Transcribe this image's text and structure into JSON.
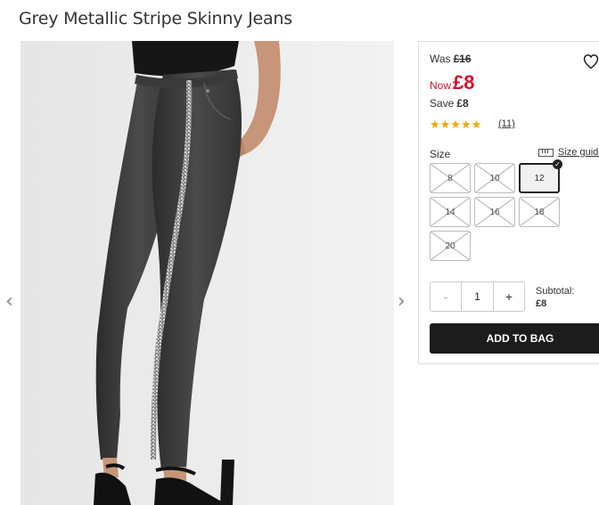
{
  "product": {
    "title": "Grey Metallic Stripe Skinny Jeans"
  },
  "gallery": {
    "prev_icon": "chevron-left-icon",
    "prev_glyph": "‹",
    "next_icon": "chevron-right-icon",
    "next_glyph": "›"
  },
  "pricing": {
    "was_label": "Was",
    "was_price": "£16",
    "now_label": "Now",
    "now_price": "£8",
    "save_label": "Save",
    "save_amount": "£8",
    "now_color": "#d0122b"
  },
  "wishlist": {
    "icon": "heart-icon"
  },
  "rating": {
    "stars": "★★★★★",
    "value_out_of_5": 5,
    "review_count": "(11)",
    "star_color": "#f2a900"
  },
  "size": {
    "label": "Size",
    "guide_label": "Size guide",
    "guide_icon": "ruler-icon",
    "options": [
      {
        "label": "8",
        "available": false,
        "selected": false
      },
      {
        "label": "10",
        "available": false,
        "selected": false
      },
      {
        "label": "12",
        "available": true,
        "selected": true
      },
      {
        "label": "14",
        "available": false,
        "selected": false
      },
      {
        "label": "16",
        "available": false,
        "selected": false
      },
      {
        "label": "18",
        "available": false,
        "selected": false
      },
      {
        "label": "20",
        "available": false,
        "selected": false
      }
    ],
    "selected_icon": "checkmark-icon",
    "selected_glyph": "✓"
  },
  "quantity": {
    "minus_label": "-",
    "value": "1",
    "plus_label": "+"
  },
  "subtotal": {
    "label": "Subtotal:",
    "value": "£8"
  },
  "cart": {
    "add_label": "ADD TO BAG",
    "button_color": "#1c1c1c"
  }
}
